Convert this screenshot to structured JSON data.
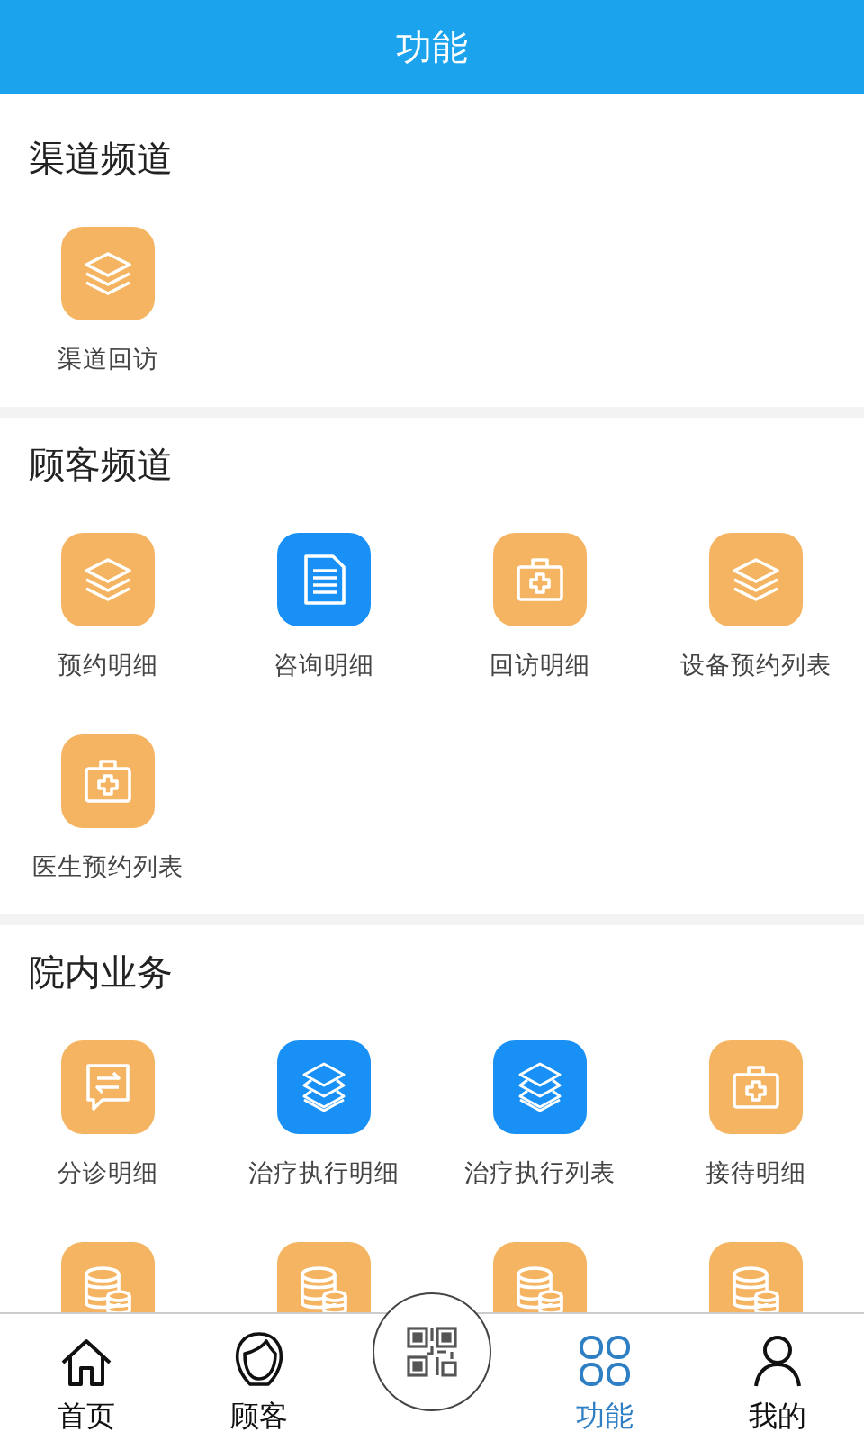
{
  "header": {
    "title": "功能"
  },
  "sections": [
    {
      "title": "渠道频道",
      "items": [
        {
          "label": "渠道回访",
          "kind": "layers",
          "color": "#f5b462"
        }
      ]
    },
    {
      "title": "顾客频道",
      "items": [
        {
          "label": "预约明细",
          "kind": "layers",
          "color": "#f5b462"
        },
        {
          "label": "咨询明细",
          "kind": "document",
          "color": "#1890f6"
        },
        {
          "label": "回访明细",
          "kind": "medkit",
          "color": "#f5b462"
        },
        {
          "label": "设备预约列表",
          "kind": "layers",
          "color": "#f5b462"
        },
        {
          "label": "医生预约列表",
          "kind": "medkit",
          "color": "#f5b462"
        }
      ]
    },
    {
      "title": "院内业务",
      "items": [
        {
          "label": "分诊明细",
          "kind": "chat",
          "color": "#f5b462"
        },
        {
          "label": "治疗执行明细",
          "kind": "stack",
          "color": "#1890f6"
        },
        {
          "label": "治疗执行列表",
          "kind": "stack",
          "color": "#1890f6"
        },
        {
          "label": "接待明细",
          "kind": "medkit",
          "color": "#f5b462"
        },
        {
          "kind": "database",
          "color": "#f5b462"
        },
        {
          "kind": "database",
          "color": "#f5b462"
        },
        {
          "kind": "database",
          "color": "#f5b462"
        },
        {
          "kind": "database",
          "color": "#f5b462"
        }
      ]
    }
  ],
  "tabbar": {
    "tabs": [
      {
        "label": "首页",
        "kind": "home",
        "selected": false
      },
      {
        "label": "顾客",
        "kind": "customer",
        "selected": false
      },
      {
        "label": "功能",
        "kind": "grid",
        "selected": true
      },
      {
        "label": "我的",
        "kind": "user",
        "selected": false
      }
    ]
  }
}
